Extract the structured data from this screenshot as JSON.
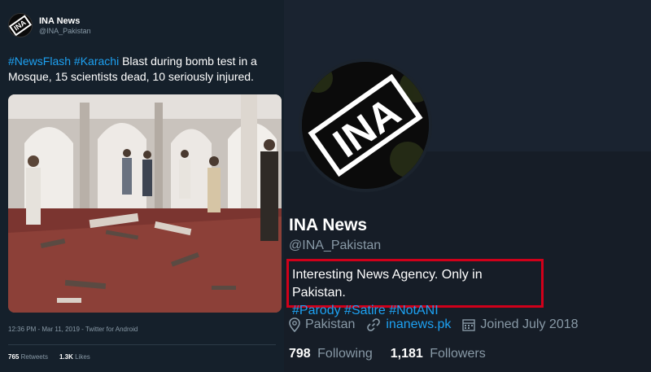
{
  "tweet": {
    "author_name": "INA News",
    "author_handle": "@INA_Pakistan",
    "hashtag_1": "#NewsFlash",
    "hashtag_2": "#Karachi",
    "text": "Blast during bomb test in a Mosque, 15 scientists dead, 10 seriously injured.",
    "photo_icon": "mosque-interior-photo",
    "timestamp": "12:36 PM - Mar 11, 2019 - Twitter for Android",
    "retweets_count": "765",
    "retweets_label": "Retweets",
    "likes_count": "1.3K",
    "likes_label": "Likes",
    "avatar_text": "INA"
  },
  "profile": {
    "name": "INA News",
    "handle": "@INA_Pakistan",
    "avatar_text": "INA",
    "bio": "Interesting News Agency. Only in Pakistan.",
    "bio_tags": [
      "#Parody",
      "#Satire",
      "#NotANI"
    ],
    "location": "Pakistan",
    "website": "inanews.pk",
    "joined": "Joined July 2018",
    "following_count": "798",
    "following_label": "Following",
    "followers_count": "1,181",
    "followers_label": "Followers",
    "location_icon": "location-pin-icon",
    "link_icon": "link-icon",
    "calendar_icon": "calendar-icon"
  },
  "colors": {
    "background": "#15202b",
    "accent": "#1da1f2",
    "muted": "#8899a6",
    "highlight_box": "#d0001a"
  }
}
